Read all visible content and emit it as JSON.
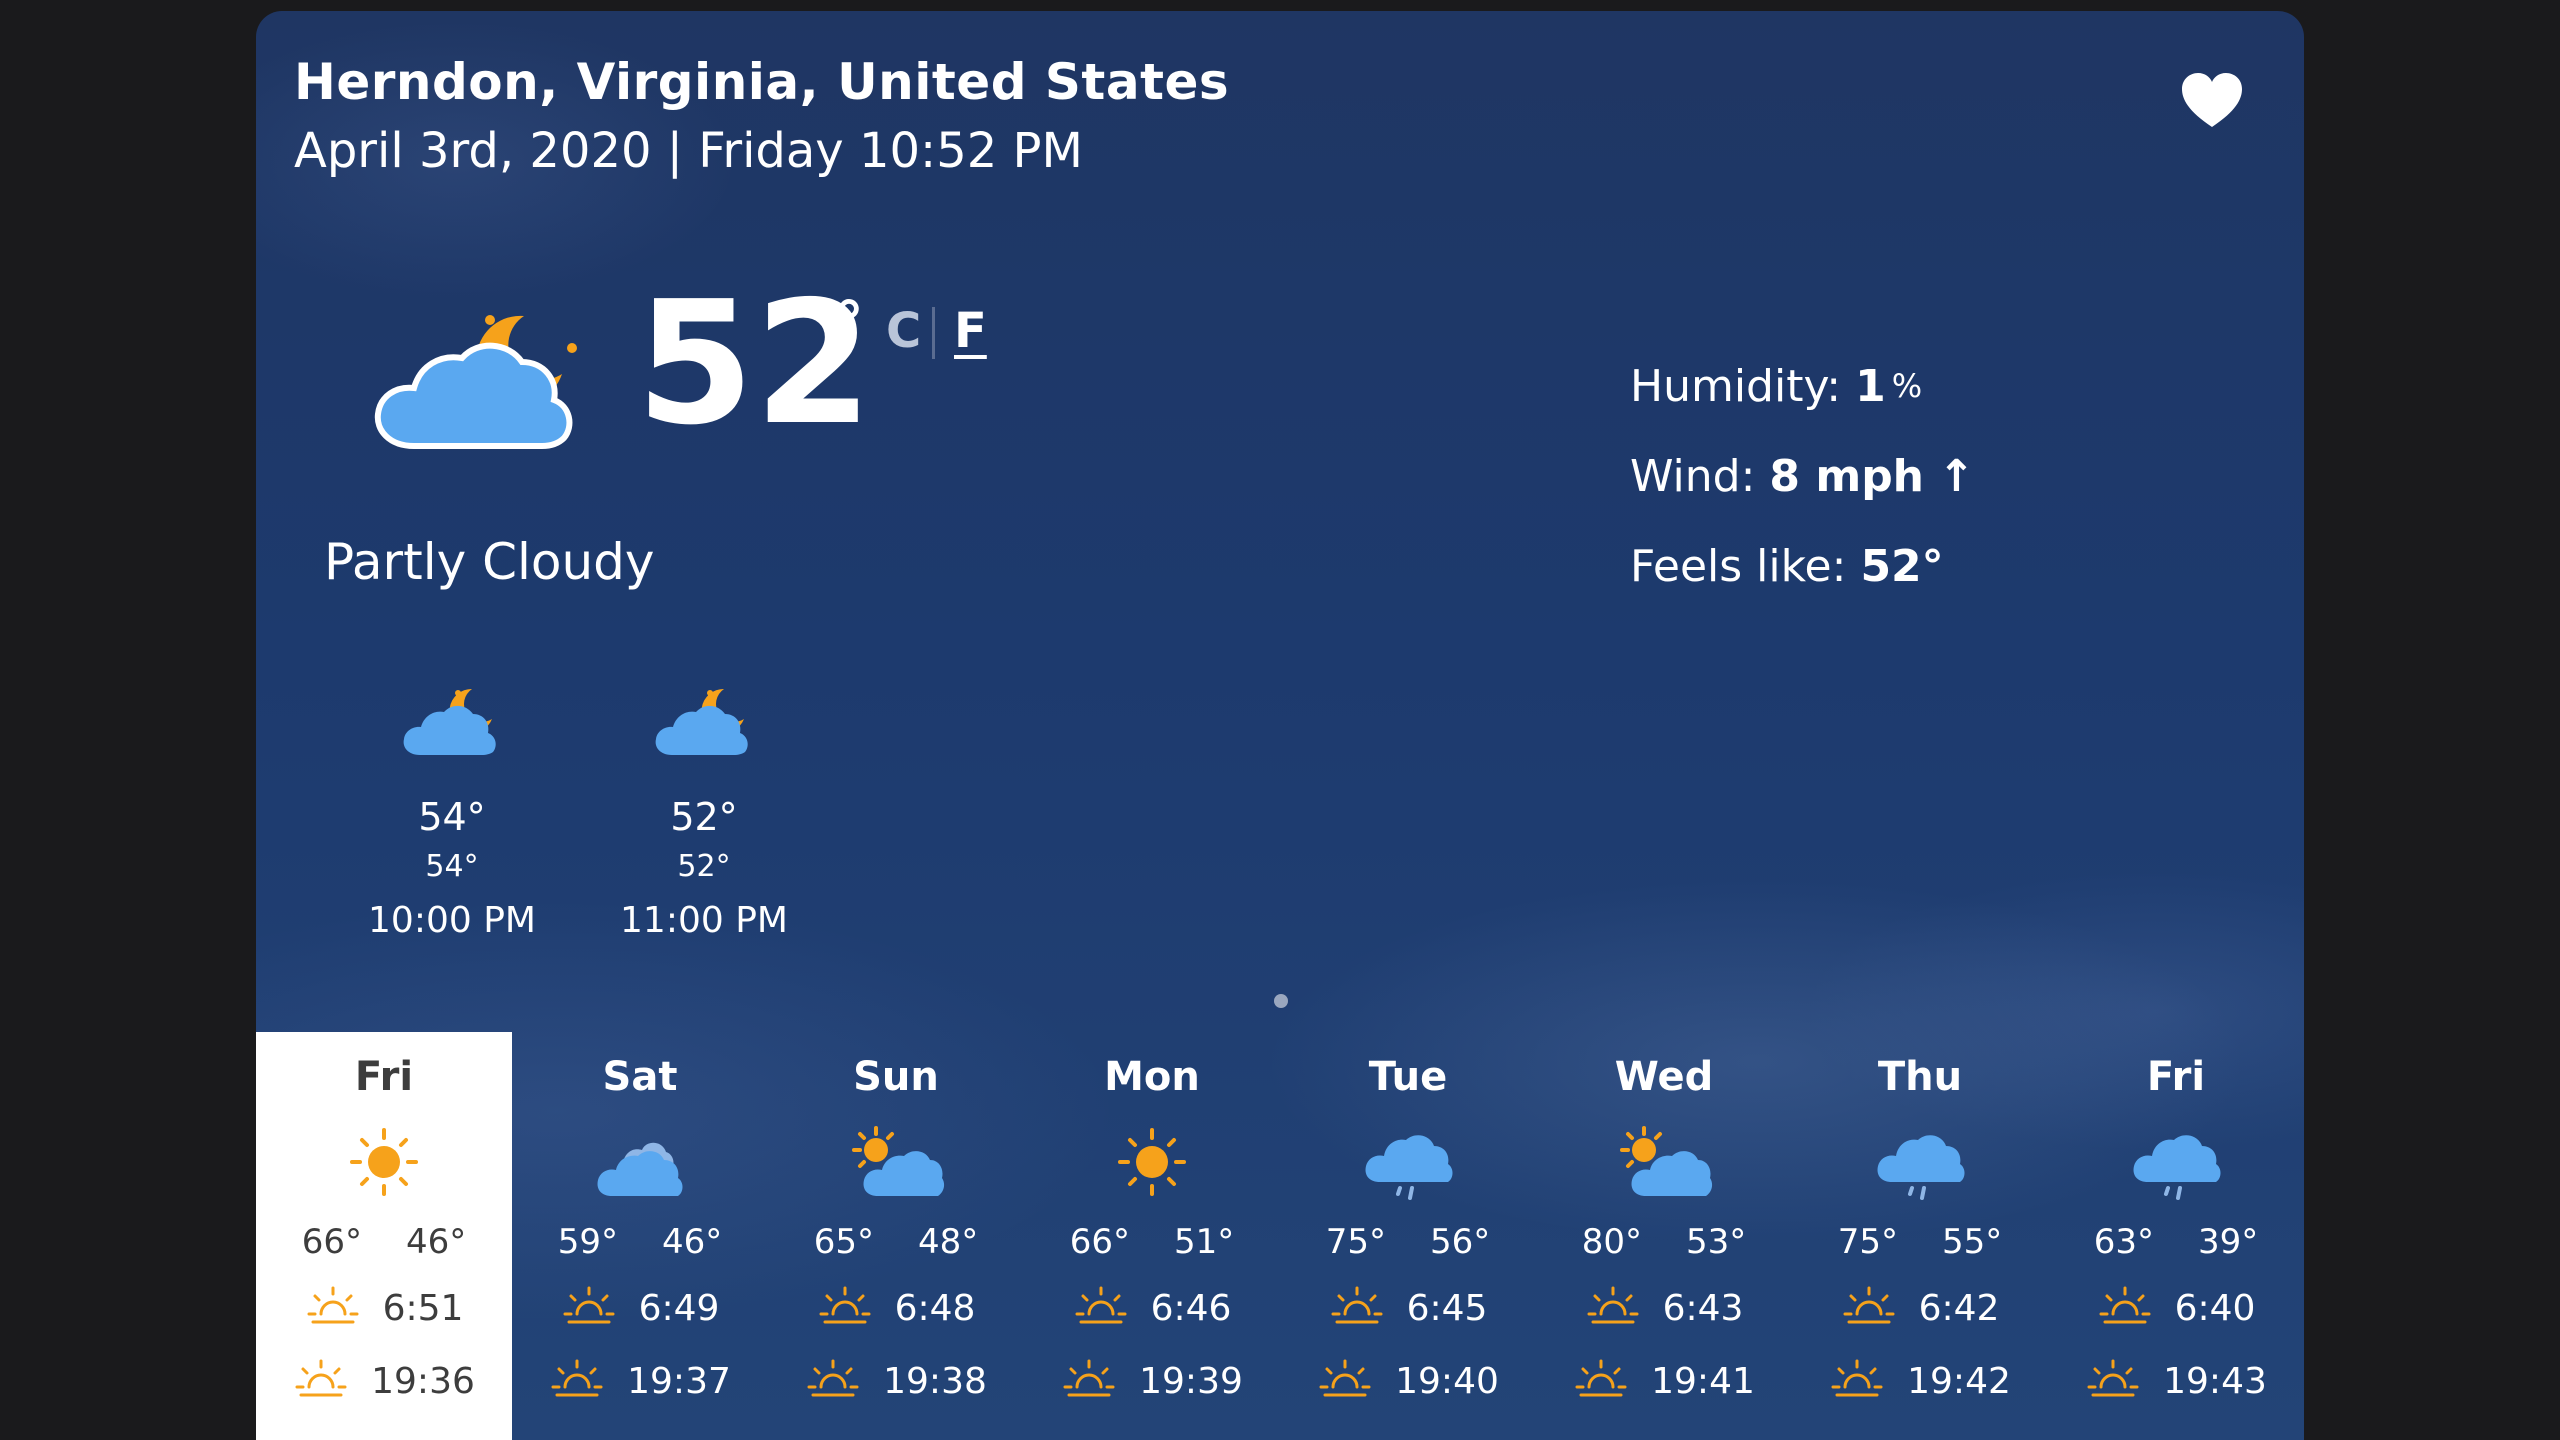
{
  "location": "Herndon, Virginia, United States",
  "datetime": "April 3rd, 2020 | Friday 10:52 PM",
  "current": {
    "temp": "52",
    "degree_symbol": "°",
    "unit_c": "C",
    "unit_f": "F",
    "condition": "Partly Cloudy",
    "icon": "partly-cloudy-night-icon"
  },
  "stats": {
    "humidity_label": "Humidity:",
    "humidity_value": "1",
    "humidity_unit": "%",
    "wind_label": "Wind:",
    "wind_value": "8 mph",
    "wind_arrow": "↑",
    "feels_label": "Feels like:",
    "feels_value": "52°"
  },
  "hourly": [
    {
      "temp": "54°",
      "feels": "54°",
      "time": "10:00 PM",
      "icon": "partly-cloudy-night-icon"
    },
    {
      "temp": "52°",
      "feels": "52°",
      "time": "11:00 PM",
      "icon": "partly-cloudy-night-icon"
    }
  ],
  "daily": [
    {
      "day": "Fri",
      "hi": "66°",
      "lo": "46°",
      "sunrise": "6:51",
      "sunset": "19:36",
      "icon": "sun-icon",
      "active": true
    },
    {
      "day": "Sat",
      "hi": "59°",
      "lo": "46°",
      "sunrise": "6:49",
      "sunset": "19:37",
      "icon": "cloudy-icon",
      "active": false
    },
    {
      "day": "Sun",
      "hi": "65°",
      "lo": "48°",
      "sunrise": "6:48",
      "sunset": "19:38",
      "icon": "partly-sunny-icon",
      "active": false
    },
    {
      "day": "Mon",
      "hi": "66°",
      "lo": "51°",
      "sunrise": "6:46",
      "sunset": "19:39",
      "icon": "sun-icon",
      "active": false
    },
    {
      "day": "Tue",
      "hi": "75°",
      "lo": "56°",
      "sunrise": "6:45",
      "sunset": "19:40",
      "icon": "rain-icon",
      "active": false
    },
    {
      "day": "Wed",
      "hi": "80°",
      "lo": "53°",
      "sunrise": "6:43",
      "sunset": "19:41",
      "icon": "partly-sunny-icon",
      "active": false
    },
    {
      "day": "Thu",
      "hi": "75°",
      "lo": "55°",
      "sunrise": "6:42",
      "sunset": "19:42",
      "icon": "rain-icon",
      "active": false
    },
    {
      "day": "Fri",
      "hi": "63°",
      "lo": "39°",
      "sunrise": "6:40",
      "sunset": "19:43",
      "icon": "rain-icon",
      "active": false
    }
  ],
  "colors": {
    "card_bg": "#1f3663",
    "cloud": "#5aa8f0",
    "moon": "#f6a21b",
    "sun": "#f6a21b",
    "active_day_bg": "#ffffff"
  }
}
